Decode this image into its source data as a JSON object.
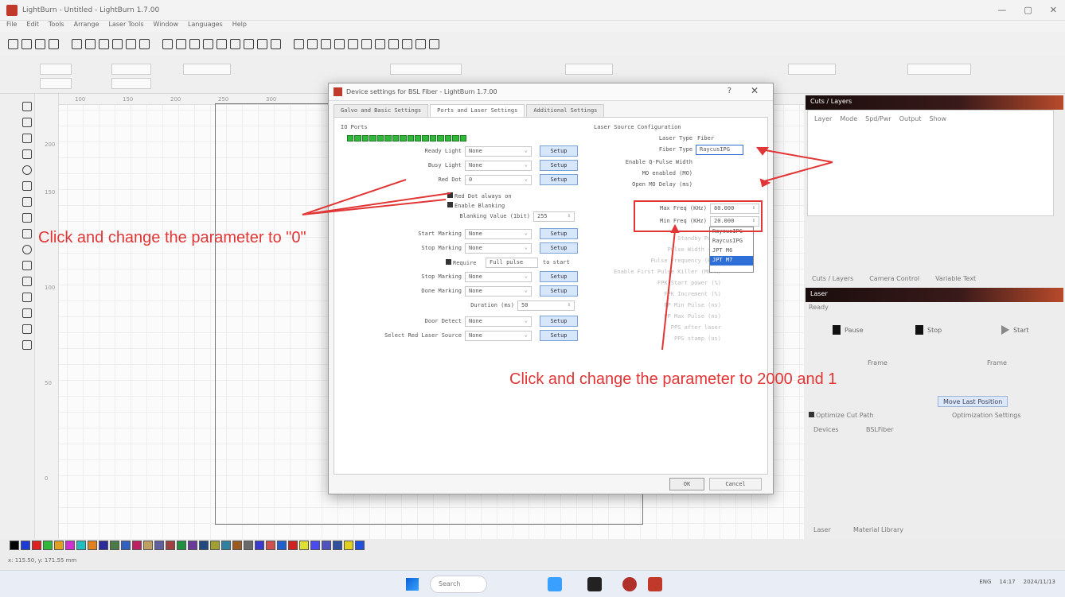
{
  "window": {
    "title": "LightBurn - Untitled - LightBurn 1.7.00"
  },
  "menu": [
    "File",
    "Edit",
    "Tools",
    "Arrange",
    "Laser Tools",
    "Window",
    "Languages",
    "Help"
  ],
  "ruler": {
    "top": [
      "100",
      "150",
      "200",
      "250",
      "300"
    ],
    "left": [
      "200",
      "150",
      "100",
      "50",
      "0"
    ]
  },
  "dialog": {
    "title": "Device settings for BSL Fiber - LightBurn 1.7.00",
    "tabs": [
      "Galvo and Basic Settings",
      "Ports and Laser Settings",
      "Additional Settings"
    ],
    "io_ports_label": "IO Ports",
    "left_rows": [
      {
        "label": "Ready Light",
        "value": "None",
        "button": "Setup"
      },
      {
        "label": "Busy Light",
        "value": "None",
        "button": "Setup"
      },
      {
        "label": "Red Dot",
        "value": "0",
        "button": "Setup"
      }
    ],
    "checks": {
      "red_dot_always_on": "Red Dot always on",
      "enable_blanking": "Enable Blanking"
    },
    "blanking_label": "Blanking Value (1bit)",
    "blanking_value": "255",
    "left_rows2": [
      {
        "label": "Start Marking",
        "value": "None",
        "button": "Setup"
      },
      {
        "label": "Stop Marking",
        "value": "None",
        "button": "Setup"
      }
    ],
    "require_label": "Require",
    "require_value": "Full pulse",
    "require_suffix": "to start",
    "left_rows3": [
      {
        "label": "Stop Marking",
        "value": "None",
        "button": "Setup"
      },
      {
        "label": "Done Marking",
        "value": "None",
        "button": "Setup"
      }
    ],
    "duration_label": "Duration (ms)",
    "duration_value": "50",
    "left_rows4": [
      {
        "label": "Door Detect",
        "value": "None",
        "button": "Setup"
      },
      {
        "label": "Select Red Laser Source",
        "value": "None",
        "button": "Setup"
      }
    ],
    "right_section_title": "Laser Source Configuration",
    "laser_type_label": "Laser Type",
    "laser_type_value": "Fiber",
    "fiber_type_label": "Fiber Type",
    "fiber_type_value": "RaycusIPG",
    "fiber_options": [
      "RaycusIPG",
      "RaycusIPG",
      "JPT M6",
      "JPT M7"
    ],
    "right_rows": [
      {
        "label": "Enable Q-Pulse Width",
        "value": ""
      },
      {
        "label": "MO enabled (MO)",
        "value": ""
      },
      {
        "label": "Open MO Delay (ms)",
        "value": ""
      }
    ],
    "max_freq_label": "Max Freq (KHz)",
    "max_freq_value": "80.000",
    "min_freq_label": "Min Freq (KHz)",
    "min_freq_value": "20.000",
    "faded_rows": [
      "Standby Pulse",
      "Pulse Width (ns)",
      "Pulse Frequency (KHz)",
      "Enable First Pulse Killer (MOPA)",
      "FPK Start power (%)",
      "FPK Increment (%)",
      "PP Min Pulse (ns)",
      "PP Max Pulse (ns)",
      "PPS after laser",
      "PPS stamp (us)"
    ],
    "ok": "OK",
    "cancel": "Cancel"
  },
  "right_panel": {
    "cuts_title": "Cuts / Layers",
    "cuts_columns": [
      "Layer",
      "Mode",
      "Spd/Pwr",
      "Output",
      "Show"
    ],
    "tabs": [
      "Cuts / Layers",
      "Camera Control",
      "Variable Text"
    ],
    "laser_title": "Laser",
    "status": "Ready",
    "pause": "Pause",
    "stop": "Stop",
    "start": "Start",
    "frame1": "Frame",
    "frame2": "Frame",
    "move_btn": "Move Last Position",
    "optimize_check": "Optimize Cut Path",
    "optimize_btn": "Optimization Settings",
    "devices_label": "Devices",
    "device_value": "BSLFiber",
    "bottom_tabs": [
      "Laser",
      "Material Library"
    ]
  },
  "annotations": {
    "left": "Click and change the parameter to  \"0\"",
    "right": "Click and change the parameter to 2000 and 1"
  },
  "status_bar": {
    "text": "x: 115.50, y: 171.55 mm"
  },
  "taskbar": {
    "search": "Search",
    "time": "14:17",
    "date": "2024/11/13",
    "lang": "ENG"
  },
  "colors": {
    "accent": "#e23535",
    "io_green": "#2fb83a",
    "setup_blue": "#d6e6fb"
  },
  "palette": [
    "#000000",
    "#1f3bd6",
    "#e02020",
    "#2fb83a",
    "#e0a020",
    "#d22fd2",
    "#20c0c0",
    "#e08020",
    "#2a2a9a",
    "#4a7a4a",
    "#3060c0",
    "#c02060",
    "#c0a060",
    "#6060a0",
    "#a04040",
    "#209040",
    "#6a3a9a",
    "#204a80",
    "#a0a030",
    "#3080a0",
    "#9a5a20",
    "#6a6a6a",
    "#3a3ad0",
    "#d05050",
    "#2060d0",
    "#d02020",
    "#e0e030",
    "#4a4af0",
    "#5050c0",
    "#3050a0",
    "#e0d020",
    "#2050e0"
  ]
}
